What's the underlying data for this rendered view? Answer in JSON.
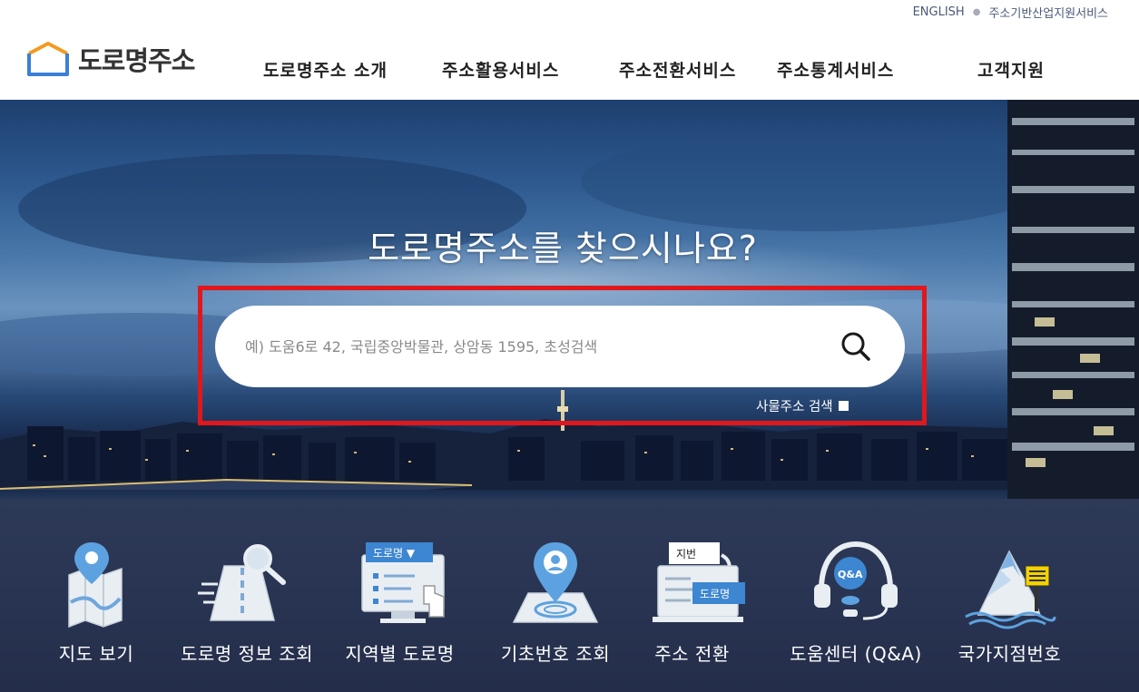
{
  "util_links": [
    "ENGLISH",
    "주소기반산업지원서비스"
  ],
  "logo": {
    "text": "도로명주소"
  },
  "gnb": [
    "도로명주소 소개",
    "주소활용서비스",
    "주소전환서비스",
    "주소통계서비스",
    "고객지원"
  ],
  "hero": {
    "title": "도로명주소를 찾으시나요?",
    "search_placeholder": "예) 도움6로 42, 국립중앙박물관, 상암동 1595, 초성검색",
    "building_search_label": "사물주소 검색"
  },
  "quick_menu": [
    {
      "label": "지도 보기",
      "icon": "map-icon"
    },
    {
      "label": "도로명 정보 조회",
      "icon": "road-search-icon"
    },
    {
      "label": "지역별 도로명",
      "icon": "region-road-icon",
      "badge": "도로명 ▼"
    },
    {
      "label": "기초번호 조회",
      "icon": "basic-number-icon"
    },
    {
      "label": "주소 전환",
      "icon": "address-convert-icon",
      "badges": [
        "지번",
        "도로명"
      ]
    },
    {
      "label": "도움센터 (Q&A)",
      "icon": "helpdesk-icon",
      "badge": "Q&A"
    },
    {
      "label": "국가지점번호",
      "icon": "national-point-icon"
    }
  ],
  "colors": {
    "accent_red": "#e1171c",
    "quick_bg": "#283351",
    "logo_blue": "#3a7fd8",
    "logo_orange": "#f29b1f"
  }
}
